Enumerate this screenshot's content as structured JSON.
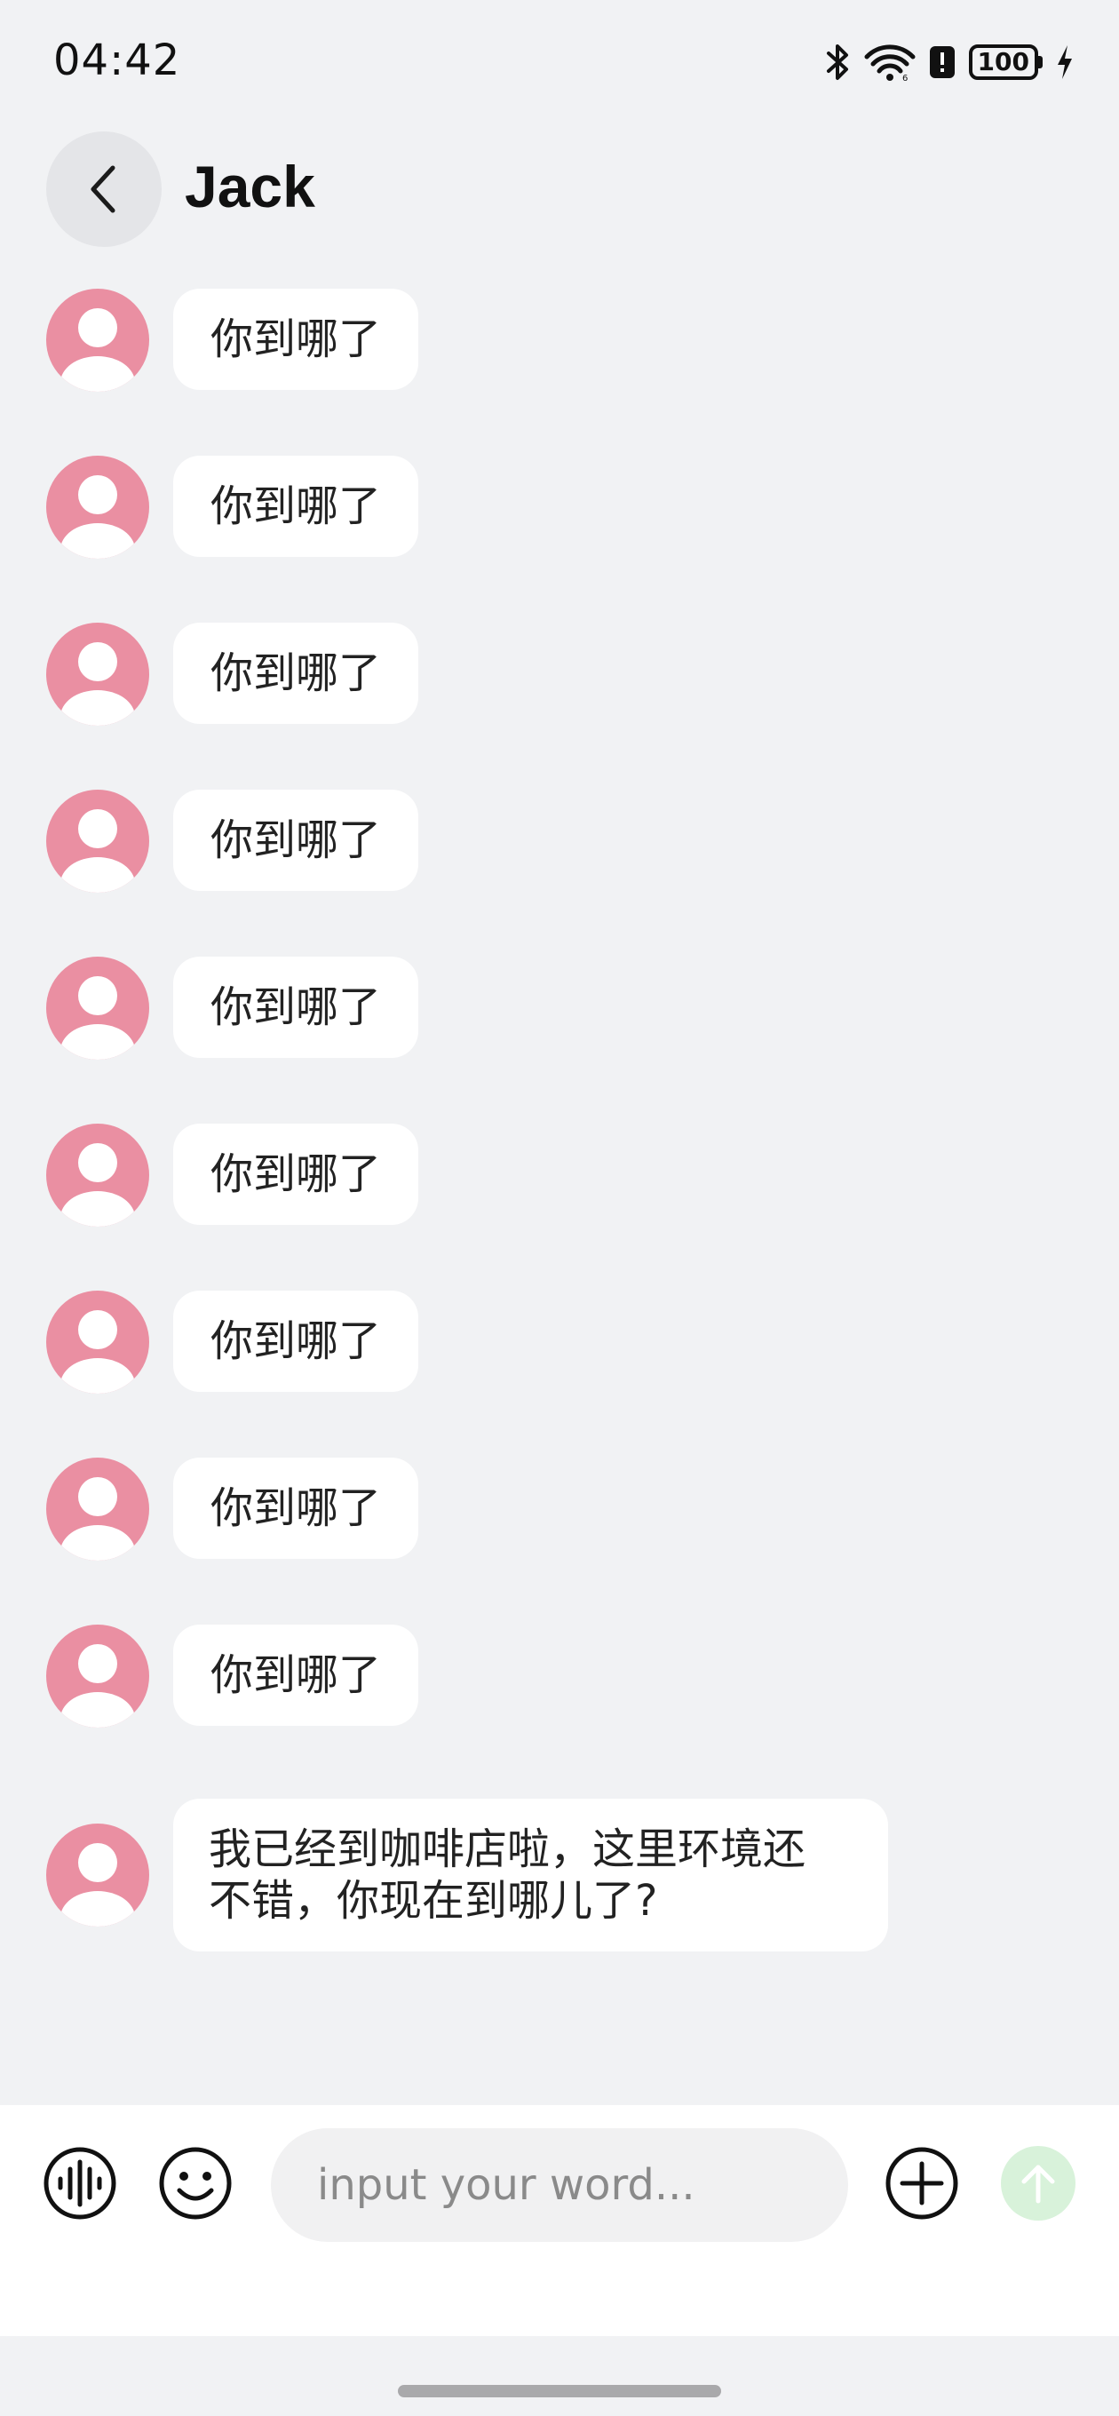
{
  "status_bar": {
    "time": "04:42",
    "battery_level": "100",
    "icons": [
      "bluetooth-icon",
      "wifi-icon",
      "alert-icon",
      "battery-icon",
      "charging-icon"
    ]
  },
  "header": {
    "back_icon": "chevron-left-icon",
    "contact_name": "Jack"
  },
  "messages": [
    {
      "text": "你到哪了"
    },
    {
      "text": "你到哪了"
    },
    {
      "text": "你到哪了"
    },
    {
      "text": "你到哪了"
    },
    {
      "text": "你到哪了"
    },
    {
      "text": "你到哪了"
    },
    {
      "text": "你到哪了"
    },
    {
      "text": "你到哪了"
    },
    {
      "text": "你到哪了"
    },
    {
      "text_line1": "我已经到咖啡店啦，这里环境还",
      "text_line2": "不错，你现在到哪儿了?"
    }
  ],
  "input_bar": {
    "placeholder": "input your word...",
    "voice_icon": "voice-wave-icon",
    "emoji_icon": "smiley-icon",
    "add_icon": "plus-circle-icon",
    "send_icon": "arrow-up-icon"
  },
  "colors": {
    "background": "#f1f2f4",
    "avatar": "#ea8fa2",
    "bubble": "#ffffff",
    "send_button": "#d8f2da"
  }
}
